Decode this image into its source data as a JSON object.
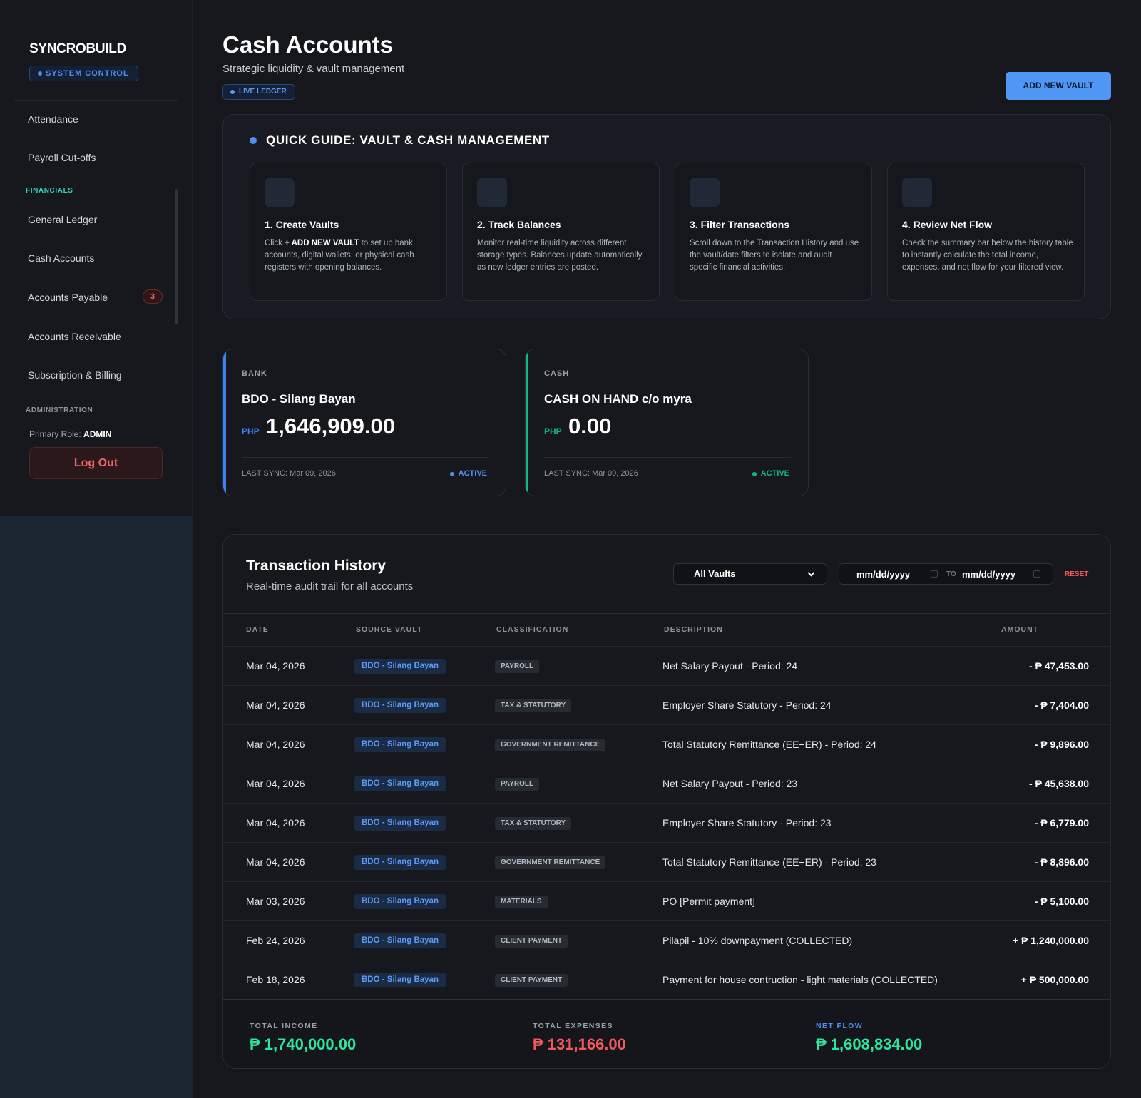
{
  "colors": {
    "accent": "#4f96f5",
    "income": "#2ee59d",
    "expense": "#f0585a",
    "financials_section": "#2dd4bf",
    "bank_bar": "#3b82f6",
    "cash_bar": "#10b981"
  },
  "sidebar": {
    "brand": "SYNCROBUILD",
    "badge": "SYSTEM CONTROL",
    "items_top": [
      "Attendance",
      "Payroll Cut-offs"
    ],
    "financials_label": "FINANCIALS",
    "financial_items": [
      "General Ledger",
      "Cash Accounts",
      "Accounts Payable",
      "Accounts Receivable",
      "Subscription & Billing"
    ],
    "payable_count": "3",
    "admin_label": "ADMINISTRATION",
    "role_label": "Primary Role:",
    "role_value": "ADMIN",
    "logout": "Log Out"
  },
  "header": {
    "title": "Cash Accounts",
    "subtitle": "Strategic liquidity & vault management",
    "live_badge": "LIVE LEDGER",
    "add_button": "ADD NEW VAULT"
  },
  "guide": {
    "title": "QUICK GUIDE: VAULT & CASH MANAGEMENT",
    "steps": [
      {
        "title": "1. Create Vaults",
        "pre": "Click ",
        "bold": "+ ADD NEW VAULT",
        "post": " to set up bank accounts, digital wallets, or physical cash registers with opening balances."
      },
      {
        "title": "2. Track Balances",
        "pre": "Monitor real-time liquidity across different storage types. Balances update automatically as new ledger entries are posted.",
        "bold": "",
        "post": ""
      },
      {
        "title": "3. Filter Transactions",
        "pre": "Scroll down to the Transaction History and use the vault/date filters to isolate and audit specific financial activities.",
        "bold": "",
        "post": ""
      },
      {
        "title": "4. Review Net Flow",
        "pre": "Check the summary bar below the history table to instantly calculate the total income, expenses, and net flow for your filtered view.",
        "bold": "",
        "post": ""
      }
    ]
  },
  "vaults": [
    {
      "type": "BANK",
      "name": "BDO - Silang Bayan",
      "currency": "PHP",
      "balance": "1,646,909.00",
      "sync": "LAST SYNC: Mar 09, 2026",
      "status": "ACTIVE"
    },
    {
      "type": "CASH",
      "name": "CASH ON HAND c/o myra",
      "currency": "PHP",
      "balance": "0.00",
      "sync": "LAST SYNC: Mar 09, 2026",
      "status": "ACTIVE"
    }
  ],
  "history": {
    "title": "Transaction History",
    "subtitle": "Real-time audit trail for all accounts",
    "vault_filter": "All Vaults",
    "date_from": "mm/dd/yyyy",
    "date_to_label": "TO",
    "date_to": "mm/dd/yyyy",
    "reset": "RESET",
    "columns": [
      "DATE",
      "SOURCE VAULT",
      "CLASSIFICATION",
      "DESCRIPTION",
      "AMOUNT"
    ],
    "rows": [
      {
        "date": "Mar 04, 2026",
        "vault": "BDO - Silang Bayan",
        "class": "PAYROLL",
        "desc": "Net Salary Payout - Period: 24",
        "amount": "- ₱ 47,453.00"
      },
      {
        "date": "Mar 04, 2026",
        "vault": "BDO - Silang Bayan",
        "class": "TAX & STATUTORY",
        "desc": "Employer Share Statutory - Period: 24",
        "amount": "- ₱ 7,404.00"
      },
      {
        "date": "Mar 04, 2026",
        "vault": "BDO - Silang Bayan",
        "class": "GOVERNMENT REMITTANCE",
        "desc": "Total Statutory Remittance (EE+ER) - Period: 24",
        "amount": "- ₱ 9,896.00"
      },
      {
        "date": "Mar 04, 2026",
        "vault": "BDO - Silang Bayan",
        "class": "PAYROLL",
        "desc": "Net Salary Payout - Period: 23",
        "amount": "- ₱ 45,638.00"
      },
      {
        "date": "Mar 04, 2026",
        "vault": "BDO - Silang Bayan",
        "class": "TAX & STATUTORY",
        "desc": "Employer Share Statutory - Period: 23",
        "amount": "- ₱ 6,779.00"
      },
      {
        "date": "Mar 04, 2026",
        "vault": "BDO - Silang Bayan",
        "class": "GOVERNMENT REMITTANCE",
        "desc": "Total Statutory Remittance (EE+ER) - Period: 23",
        "amount": "- ₱ 8,896.00"
      },
      {
        "date": "Mar 03, 2026",
        "vault": "BDO - Silang Bayan",
        "class": "MATERIALS",
        "desc": "PO [Permit payment]",
        "amount": "- ₱ 5,100.00"
      },
      {
        "date": "Feb 24, 2026",
        "vault": "BDO - Silang Bayan",
        "class": "CLIENT PAYMENT",
        "desc": "Pilapil - 10% downpayment (COLLECTED)",
        "amount": "+ ₱ 1,240,000.00"
      },
      {
        "date": "Feb 18, 2026",
        "vault": "BDO - Silang Bayan",
        "class": "CLIENT PAYMENT",
        "desc": "Payment for house contruction - light materials (COLLECTED)",
        "amount": "+ ₱ 500,000.00"
      }
    ],
    "summary": {
      "income_label": "TOTAL INCOME",
      "income_value": "₱ 1,740,000.00",
      "expense_label": "TOTAL EXPENSES",
      "expense_value": "₱ 131,166.00",
      "net_label": "NET FLOW",
      "net_value": "₱ 1,608,834.00"
    }
  }
}
